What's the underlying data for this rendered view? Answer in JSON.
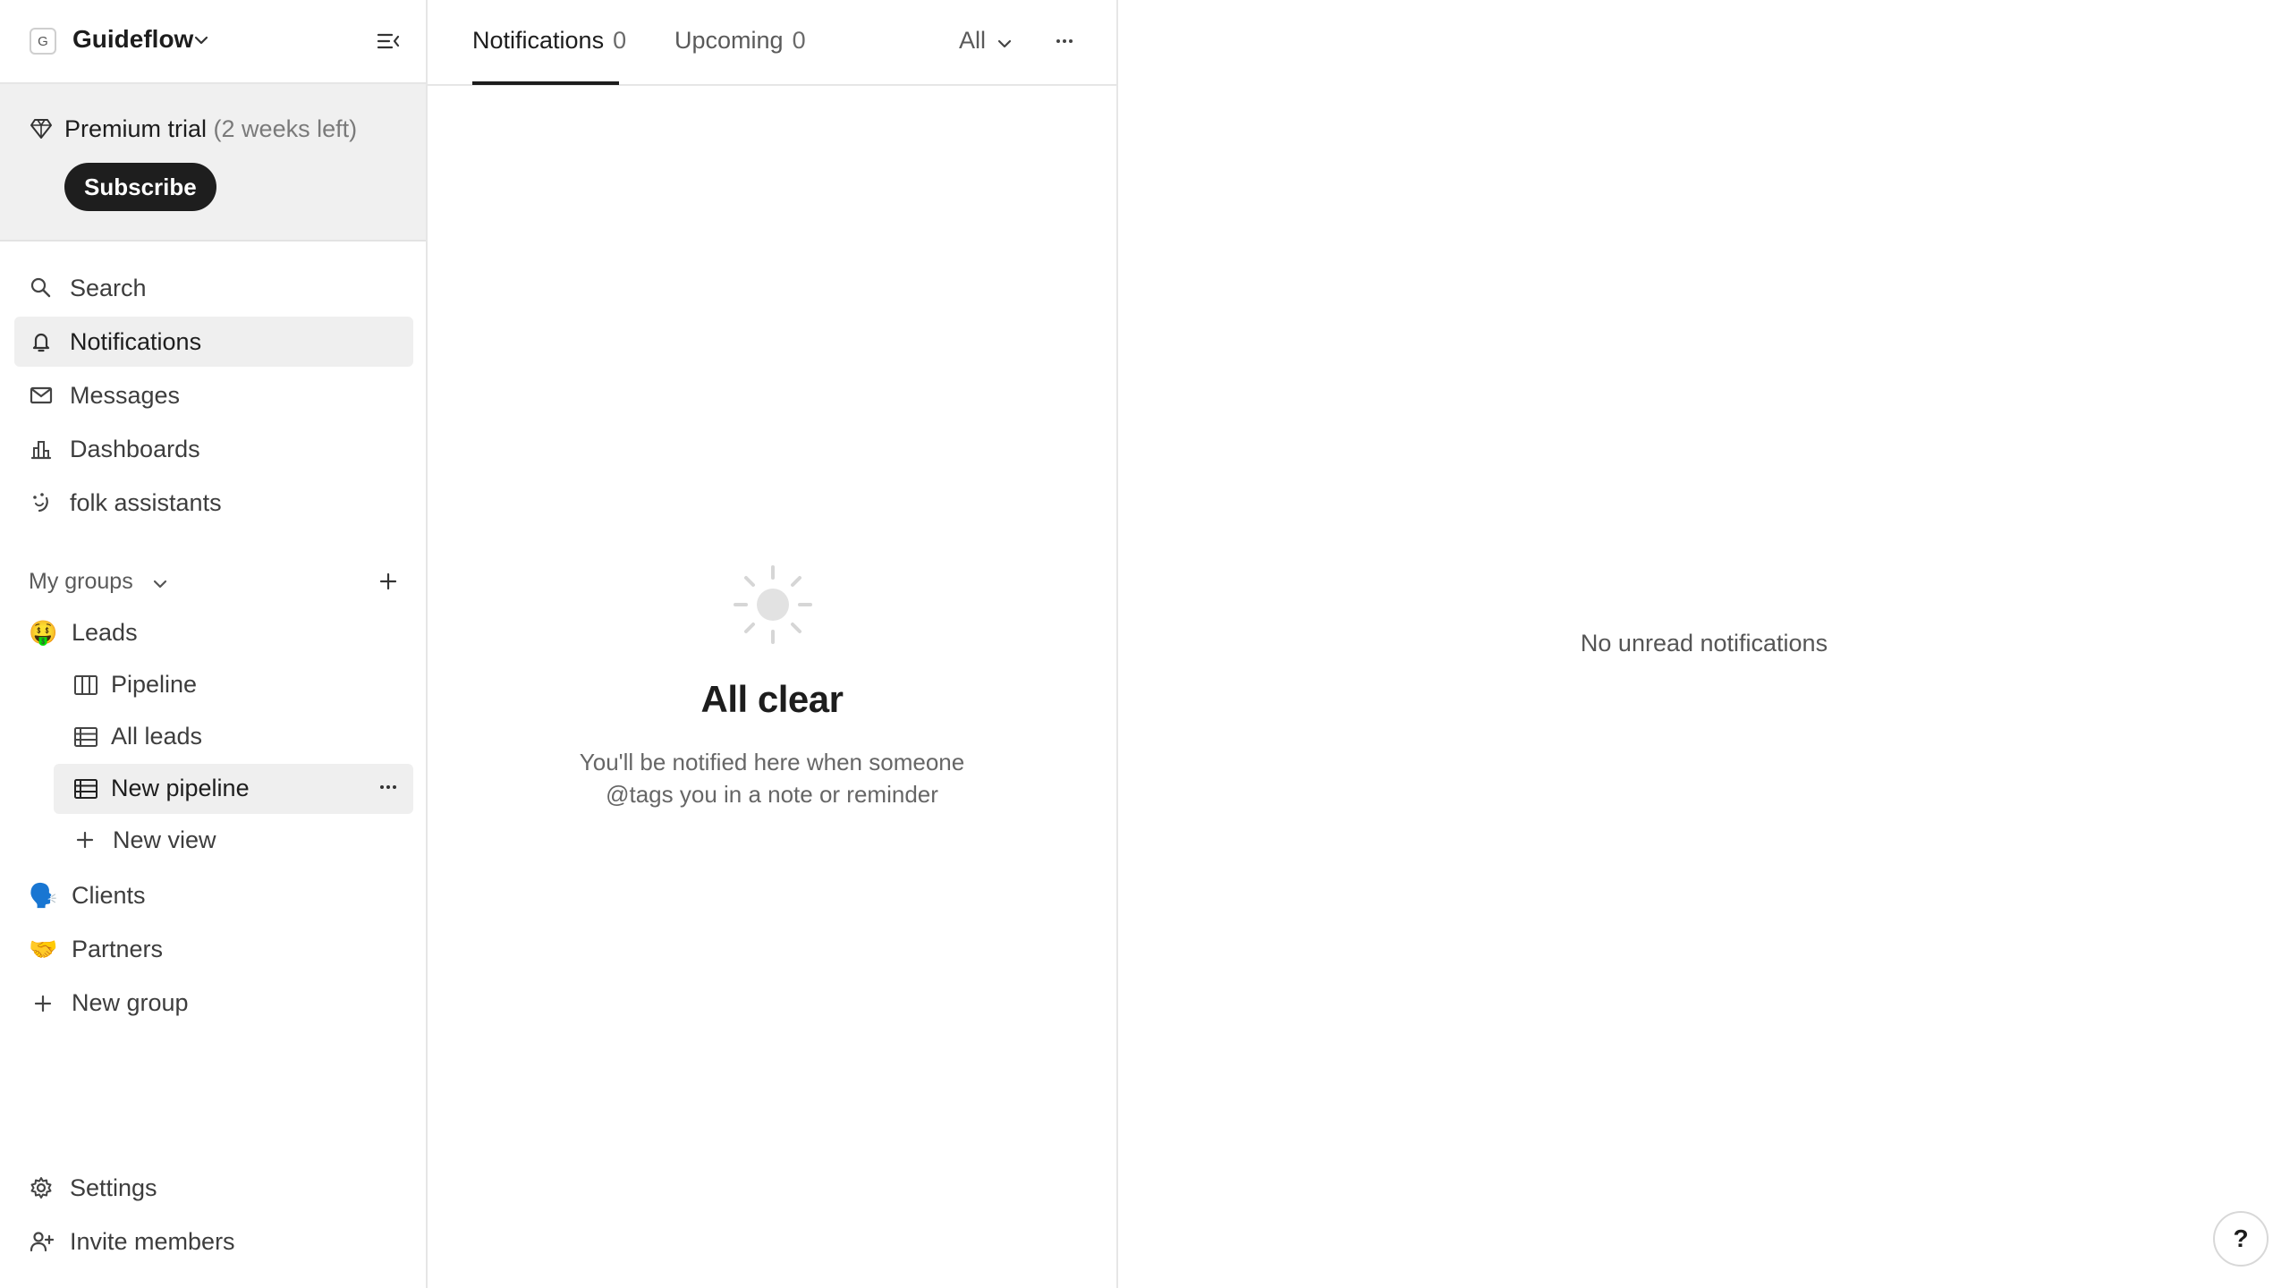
{
  "workspace": {
    "initial": "G",
    "name": "Guideflow"
  },
  "trial": {
    "label": "Premium trial",
    "remaining": "(2 weeks left)",
    "subscribe_label": "Subscribe"
  },
  "nav": {
    "search": "Search",
    "notifications": "Notifications",
    "messages": "Messages",
    "dashboards": "Dashboards",
    "assistants": "folk assistants"
  },
  "groups": {
    "header": "My groups",
    "leads": {
      "emoji": "🤑",
      "label": "Leads"
    },
    "views": {
      "pipeline": "Pipeline",
      "all_leads": "All leads",
      "new_pipeline": "New pipeline",
      "new_view": "New view"
    },
    "clients": {
      "emoji": "🗣️",
      "label": "Clients"
    },
    "partners": {
      "emoji": "🤝",
      "label": "Partners"
    },
    "new_group": "New group"
  },
  "footer": {
    "settings": "Settings",
    "invite": "Invite members"
  },
  "notifications_panel": {
    "tabs": [
      {
        "label": "Notifications",
        "count": "0"
      },
      {
        "label": "Upcoming",
        "count": "0"
      }
    ],
    "filter": "All",
    "empty_title": "All clear",
    "empty_line1": "You'll be notified here when someone",
    "empty_line2": "@tags you in a note or reminder"
  },
  "detail": {
    "empty_text": "No unread notifications",
    "help_label": "?"
  }
}
